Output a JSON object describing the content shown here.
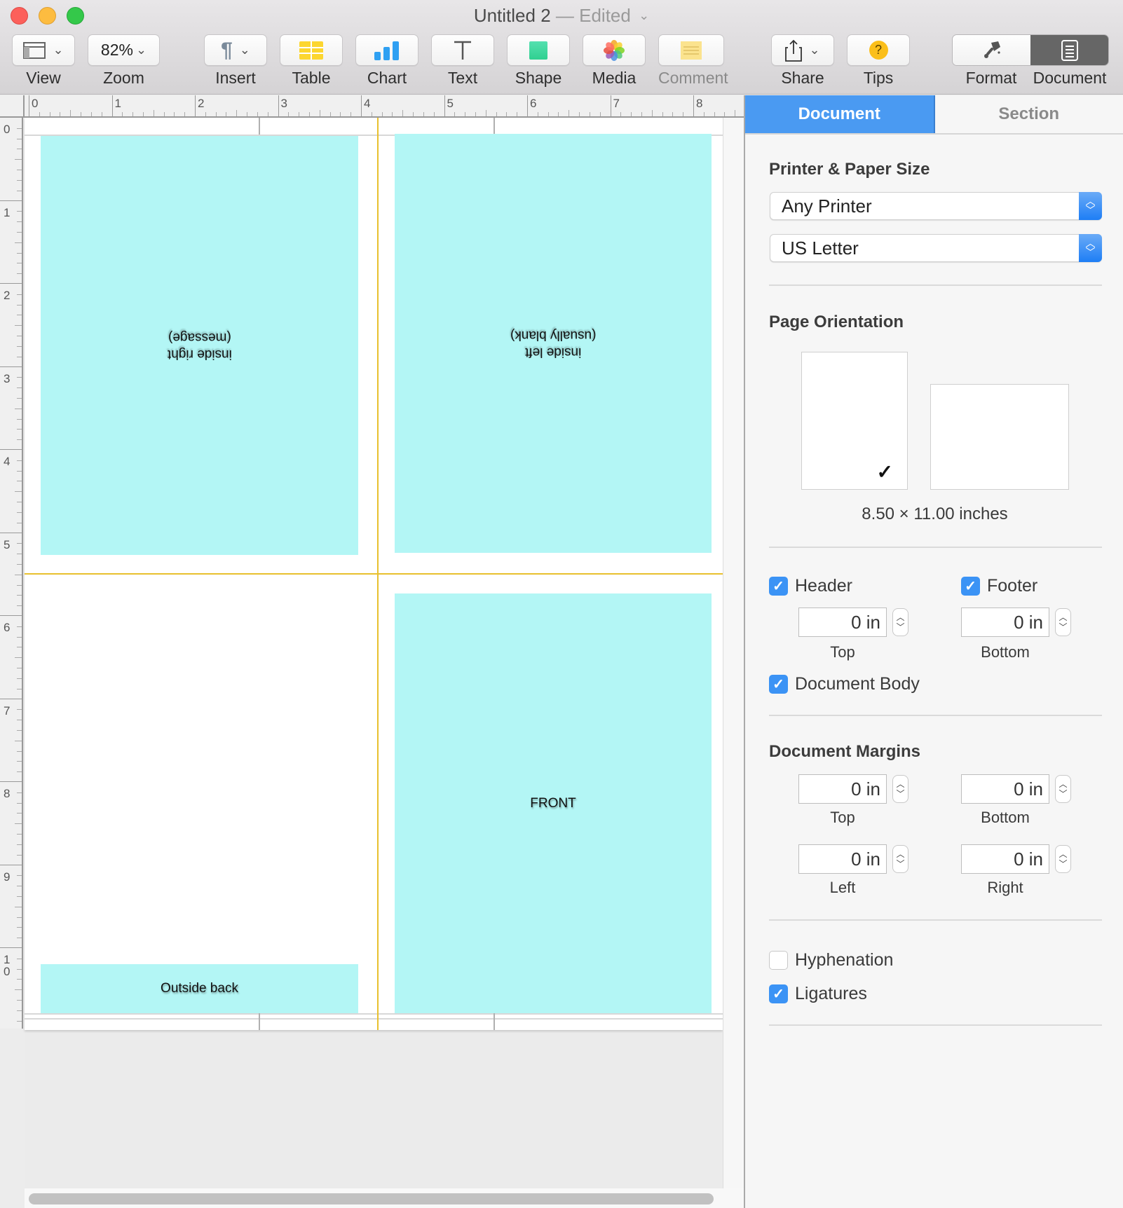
{
  "window": {
    "title": "Untitled 2",
    "edited_suffix": "— Edited"
  },
  "toolbar": {
    "view_label": "View",
    "zoom_value": "82%",
    "zoom_label": "Zoom",
    "insert_label": "Insert",
    "table_label": "Table",
    "chart_label": "Chart",
    "text_label": "Text",
    "shape_label": "Shape",
    "media_label": "Media",
    "comment_label": "Comment",
    "share_label": "Share",
    "tips_label": "Tips",
    "format_label": "Format",
    "document_label": "Document"
  },
  "ruler": {
    "horizontal": [
      "0",
      "1",
      "2",
      "3",
      "4",
      "5",
      "6",
      "7",
      "8"
    ],
    "vertical": [
      "0",
      "1",
      "2",
      "3",
      "4",
      "5",
      "6",
      "7",
      "8",
      "9",
      "10"
    ]
  },
  "document": {
    "panels": {
      "inside_right_line1": "inside right",
      "inside_right_line2": "(message)",
      "inside_left_line1": "inside left",
      "inside_left_line2": "(usually blank)",
      "front": "FRONT",
      "outside_back": "Outside back"
    },
    "panel_color": "#b3f6f5",
    "guide_color": "#e8c02e"
  },
  "inspector": {
    "tabs": [
      {
        "label": "Document",
        "active": true
      },
      {
        "label": "Section",
        "active": false
      }
    ],
    "printer_paper": {
      "title": "Printer & Paper Size",
      "printer": "Any Printer",
      "paper": "US Letter"
    },
    "orientation": {
      "title": "Page Orientation",
      "selected": "portrait",
      "size_text": "8.50 × 11.00 inches"
    },
    "header_footer": {
      "header_label": "Header",
      "header_checked": true,
      "header_value": "0 in",
      "header_caption": "Top",
      "footer_label": "Footer",
      "footer_checked": true,
      "footer_value": "0 in",
      "footer_caption": "Bottom",
      "body_label": "Document Body",
      "body_checked": true
    },
    "margins": {
      "title": "Document Margins",
      "top_value": "0 in",
      "top_caption": "Top",
      "bottom_value": "0 in",
      "bottom_caption": "Bottom",
      "left_value": "0 in",
      "left_caption": "Left",
      "right_value": "0 in",
      "right_caption": "Right"
    },
    "typography": {
      "hyphenation_label": "Hyphenation",
      "hyphenation_checked": false,
      "ligatures_label": "Ligatures",
      "ligatures_checked": true
    }
  },
  "colors": {
    "accent": "#4a9af2",
    "checkbox": "#3b93f5"
  }
}
